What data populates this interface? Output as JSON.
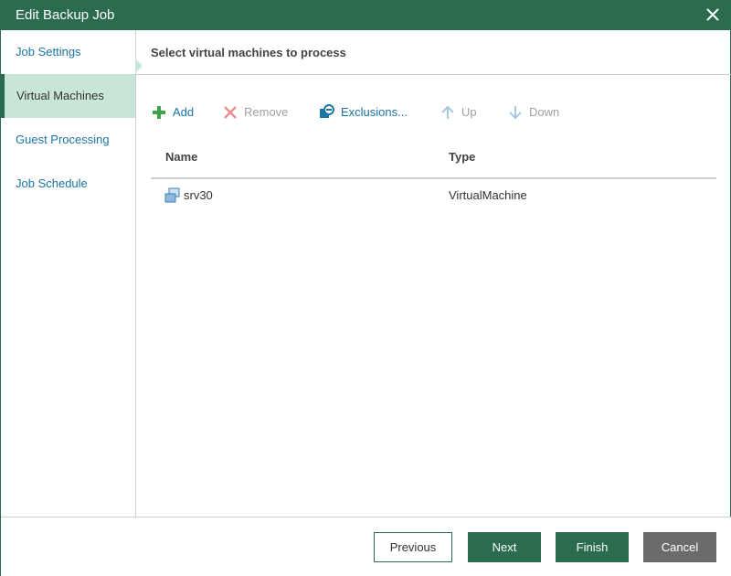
{
  "window": {
    "title": "Edit Backup Job",
    "close_icon": "close-icon"
  },
  "sidebar": {
    "items": [
      {
        "label": "Job Settings",
        "active": false
      },
      {
        "label": "Virtual Machines",
        "active": true
      },
      {
        "label": "Guest Processing",
        "active": false
      },
      {
        "label": "Job Schedule",
        "active": false
      }
    ]
  },
  "main": {
    "heading": "Select virtual machines to process",
    "toolbar": {
      "add": {
        "label": "Add",
        "icon": "plus-icon",
        "enabled": true
      },
      "remove": {
        "label": "Remove",
        "icon": "x-icon",
        "enabled": false
      },
      "exclusions": {
        "label": "Exclusions...",
        "icon": "exclusions-icon",
        "enabled": true
      },
      "up": {
        "label": "Up",
        "icon": "arrow-up-icon",
        "enabled": false
      },
      "down": {
        "label": "Down",
        "icon": "arrow-down-icon",
        "enabled": false
      }
    },
    "table": {
      "columns": [
        "Name",
        "Type"
      ],
      "rows": [
        {
          "name": "srv30",
          "type": "VirtualMachine",
          "icon": "vm-icon"
        }
      ]
    }
  },
  "footer": {
    "previous": "Previous",
    "next": "Next",
    "finish": "Finish",
    "cancel": "Cancel"
  },
  "colors": {
    "brand_green": "#2b6b4e",
    "active_nav_bg": "#c8e6d8",
    "link_blue": "#1a74a4",
    "disabled_gray": "#a0a0a0",
    "cancel_gray": "#6b6b6b"
  }
}
